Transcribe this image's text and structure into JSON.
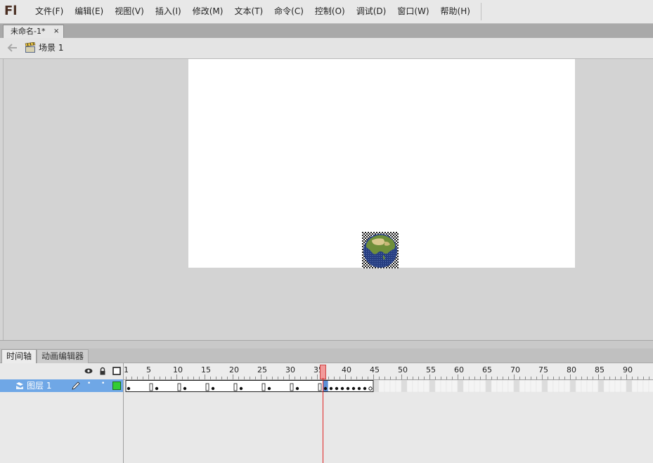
{
  "app": {
    "logo": "Fl"
  },
  "menu": [
    "文件(F)",
    "编辑(E)",
    "视图(V)",
    "插入(I)",
    "修改(M)",
    "文本(T)",
    "命令(C)",
    "控制(O)",
    "调试(D)",
    "窗口(W)",
    "帮助(H)"
  ],
  "document_tab": {
    "title": "未命名-1*",
    "close": "×"
  },
  "edit_bar": {
    "scene": "场景 1"
  },
  "panel_tabs": {
    "timeline": "时间轴",
    "motion_editor": "动画编辑器"
  },
  "timeline": {
    "layer_name": "图层 1",
    "ruler_labels": [
      "1",
      "5",
      "10",
      "15",
      "20",
      "25",
      "30",
      "35",
      "40",
      "45",
      "50",
      "55",
      "60",
      "65",
      "70",
      "75",
      "80",
      "85",
      "90"
    ],
    "current_frame": 36,
    "last_frame": 44
  },
  "colors": {
    "layer_highlight": "#6fa7e6",
    "playhead": "#e02020",
    "outline_swatch": "#33cc33"
  },
  "icons": [
    "eye-icon",
    "lock-icon",
    "outline-icon",
    "pencil-icon",
    "layer-icon",
    "scene-icon",
    "back-arrow-icon",
    "globe-symbol"
  ]
}
